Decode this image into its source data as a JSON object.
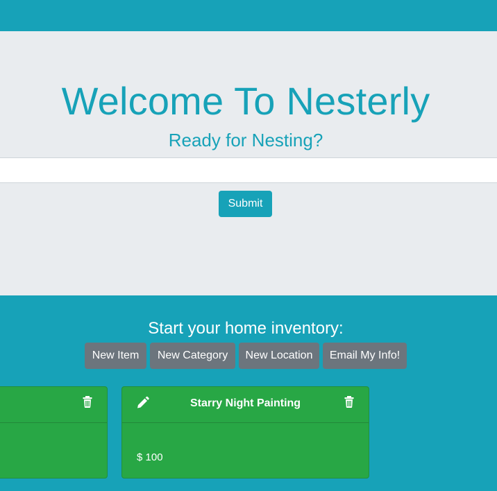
{
  "hero": {
    "title": "Welcome To Nesterly",
    "subtitle": "Ready for Nesting?",
    "input_value": "",
    "submit_label": "Submit"
  },
  "inventory": {
    "heading": "Start your home inventory:",
    "buttons": [
      "New Item",
      "New Category",
      "New Location",
      "Email My Info!"
    ]
  },
  "cards": [
    {
      "title": "",
      "price": ""
    },
    {
      "title": "Starry Night Painting",
      "price": "$ 100"
    }
  ],
  "icons": {
    "edit": "pencil-icon",
    "delete": "trash-icon"
  },
  "colors": {
    "primary": "#17a2b8",
    "hero_bg": "#e9ecef",
    "secondary": "#6c757d",
    "success": "#28a745"
  }
}
